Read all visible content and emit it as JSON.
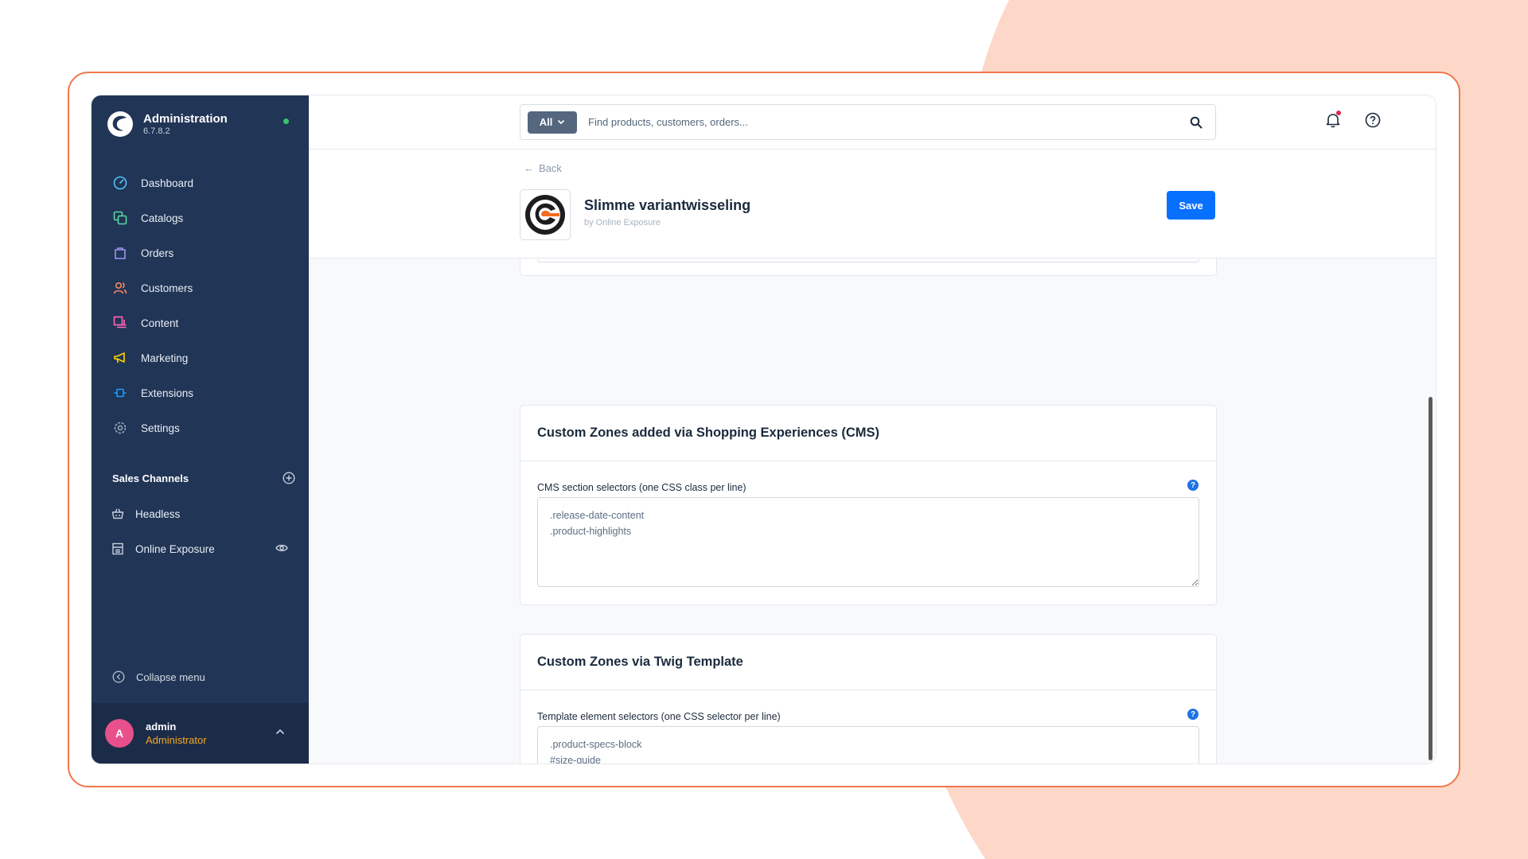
{
  "app": {
    "title": "Administration",
    "version": "6.7.8.2"
  },
  "nav": {
    "items": [
      {
        "label": "Dashboard",
        "icon": "dashboard-icon",
        "color": "#4fc3f7"
      },
      {
        "label": "Catalogs",
        "icon": "catalogs-icon",
        "color": "#57d9a3"
      },
      {
        "label": "Orders",
        "icon": "orders-icon",
        "color": "#a092f0"
      },
      {
        "label": "Customers",
        "icon": "customers-icon",
        "color": "#f88962"
      },
      {
        "label": "Content",
        "icon": "content-icon",
        "color": "#ff68b4"
      },
      {
        "label": "Marketing",
        "icon": "marketing-icon",
        "color": "#ffd700"
      },
      {
        "label": "Extensions",
        "icon": "extensions-icon",
        "color": "#189eff"
      },
      {
        "label": "Settings",
        "icon": "settings-icon",
        "color": "#9aa8b5"
      }
    ],
    "sales_channels_title": "Sales Channels",
    "sales_channels": [
      {
        "label": "Headless",
        "icon": "basket-icon"
      },
      {
        "label": "Online Exposure",
        "icon": "storefront-icon"
      }
    ],
    "collapse_label": "Collapse menu"
  },
  "user": {
    "initial": "A",
    "name": "admin",
    "role": "Administrator"
  },
  "search": {
    "filter_label": "All",
    "placeholder": "Find products, customers, orders..."
  },
  "header": {
    "back_label": "Back",
    "title": "Slimme variantwisseling",
    "vendor": "by Online Exposure",
    "save_label": "Save"
  },
  "cards": [
    {
      "title": "Custom Zones added via Shopping Experiences (CMS)",
      "field_label": "CMS section selectors (one CSS class per line)",
      "value": ".release-date-content\n.product-highlights"
    },
    {
      "title": "Custom Zones via Twig Template",
      "field_label": "Template element selectors (one CSS selector per line)",
      "value": ".product-specs-block\n#size-guide"
    }
  ],
  "colors": {
    "sidebar": "#213556",
    "accent": "#0870ff",
    "frame": "#f0784e",
    "background_shape": "#fdd8c9"
  }
}
